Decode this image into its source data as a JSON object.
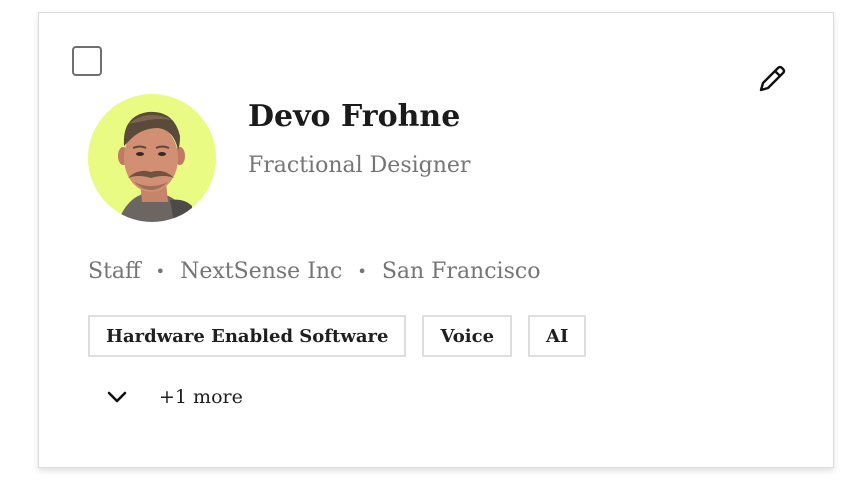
{
  "profile": {
    "name": "Devo Frohne",
    "role": "Fractional Designer",
    "avatar_bg": "#e9fb82"
  },
  "meta": {
    "type": "Staff",
    "company": "NextSense Inc",
    "location": "San Francisco",
    "separator": "•"
  },
  "tags": {
    "items": [
      "Hardware Enabled Software",
      "Voice",
      "AI"
    ],
    "more_label": "+1 more"
  },
  "icons": {
    "edit": "pencil-icon",
    "expand": "chevron-down-icon"
  }
}
